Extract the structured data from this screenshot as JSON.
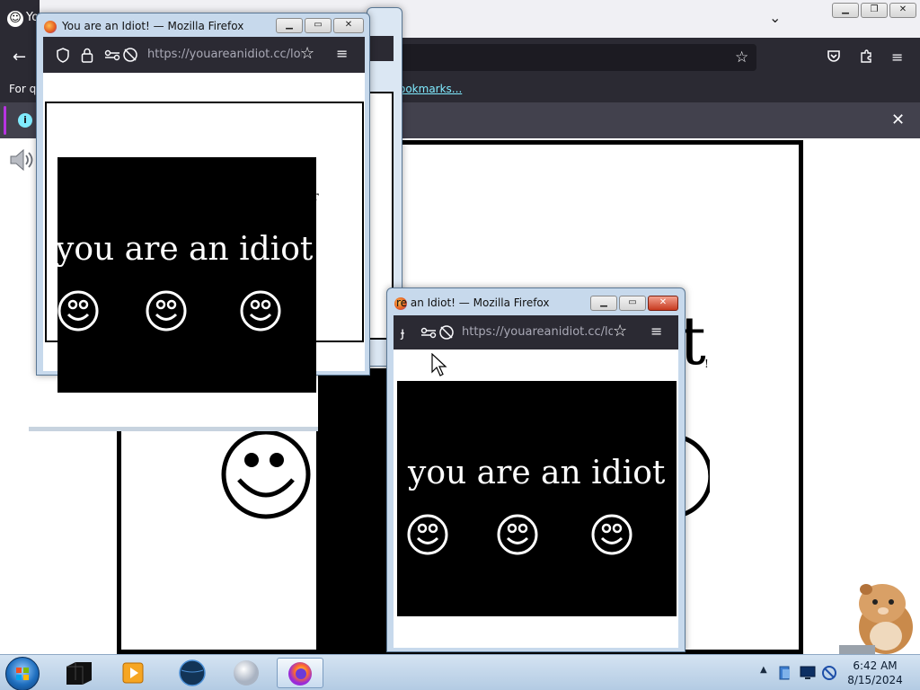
{
  "background_window": {
    "tab_title": "Yo",
    "bookmarks_prefix": "For qu",
    "bookmarks_link": "ookmarks...",
    "notification_info": "i",
    "big_partial_text": "t",
    "partial_t_small": "!"
  },
  "popup_top": {
    "title": "You are an Idiot! — Mozilla Firefox",
    "url": "https://youareanidiot.cc/lol.",
    "message": "you are an idiot",
    "partial_letter": "r",
    "smiley_count": 3
  },
  "popup_bottom": {
    "title": "re an Idiot! — Mozilla Firefox",
    "url": "https://youareanidiot.cc/lol.",
    "message": "you are an idiot",
    "smiley_count": 3
  },
  "taskbar": {
    "time": "6:42 AM",
    "date": "8/15/2024",
    "apps": [
      "start-orb",
      "terminal",
      "media-player",
      "globe",
      "sphere",
      "firefox"
    ]
  },
  "colors": {
    "toolbar": "#2b2a33",
    "urlbar": "#1c1b22",
    "accent": "#80ebff",
    "close_red": "#c73a1f"
  }
}
